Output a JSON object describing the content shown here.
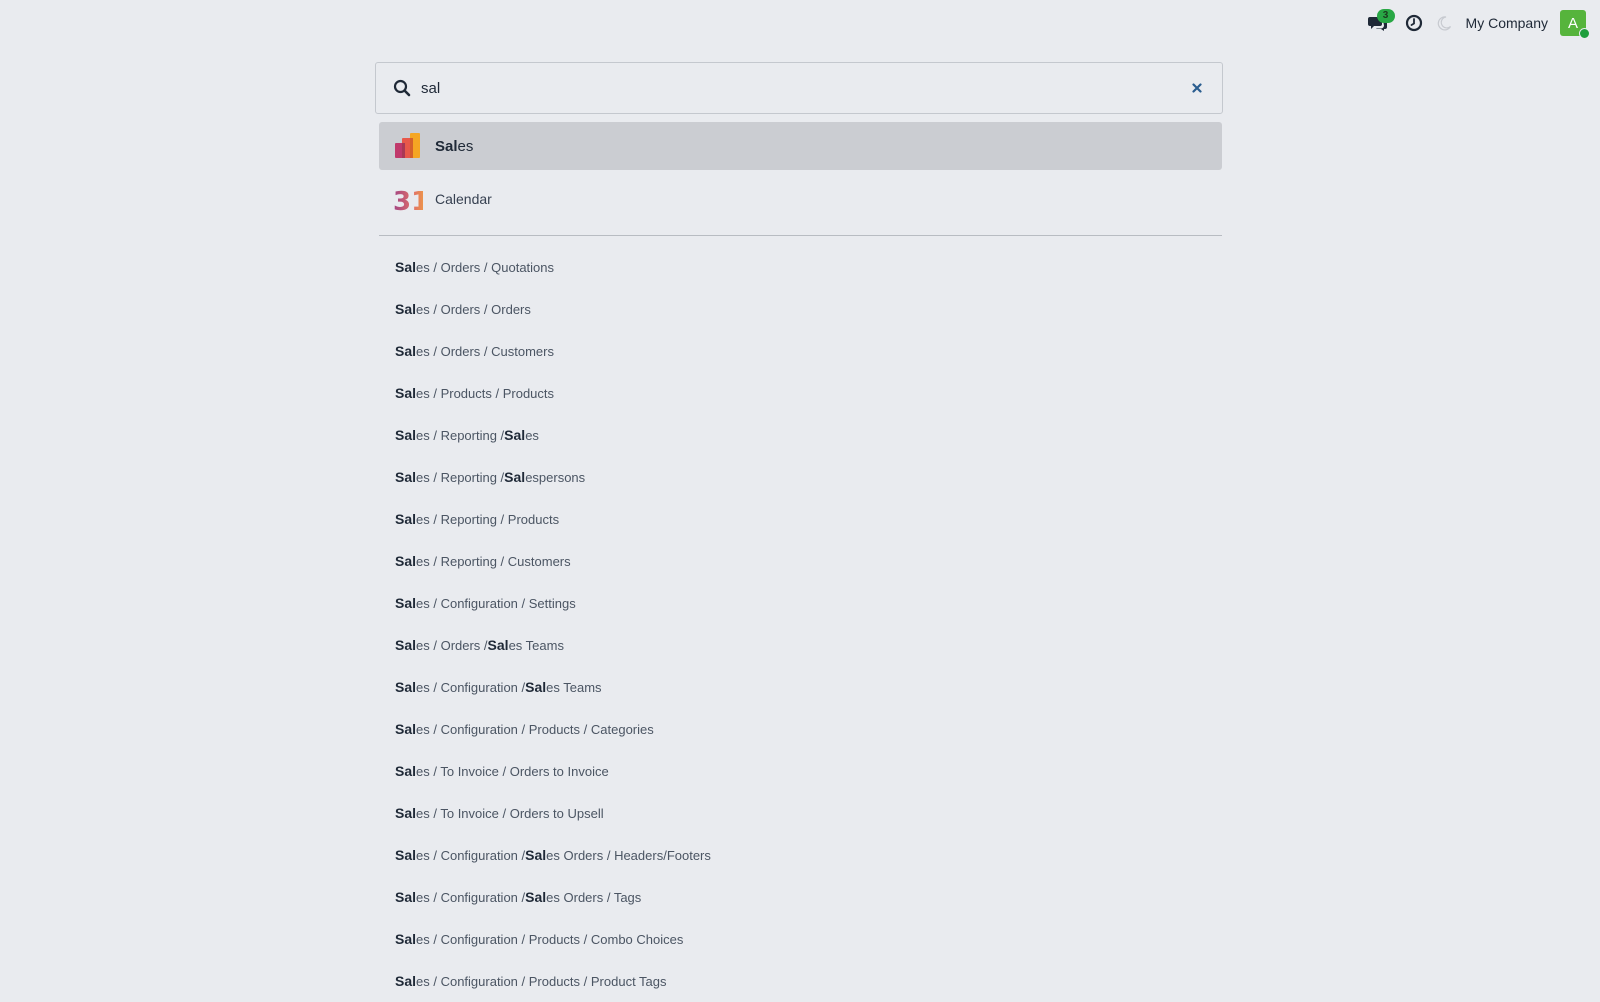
{
  "header": {
    "chat_badge": "3",
    "company": "My Company",
    "avatar_letter": "A",
    "icons": [
      "chat-icon",
      "clock-icon",
      "moon-icon"
    ]
  },
  "search": {
    "value": "sal",
    "placeholder": ""
  },
  "apps": [
    {
      "match": "Sal",
      "rest": "es",
      "icon": "sales-app-icon",
      "active": true
    },
    {
      "match": "",
      "rest": "Calendar",
      "icon": "calendar-app-icon",
      "active": false
    }
  ],
  "calendar_icon_text": "31",
  "menu_items": [
    {
      "segments": [
        {
          "t": "Sal",
          "b": true
        },
        {
          "t": "es / Orders / Quotations"
        }
      ]
    },
    {
      "segments": [
        {
          "t": "Sal",
          "b": true
        },
        {
          "t": "es / Orders / Orders"
        }
      ]
    },
    {
      "segments": [
        {
          "t": "Sal",
          "b": true
        },
        {
          "t": "es / Orders / Customers"
        }
      ]
    },
    {
      "segments": [
        {
          "t": "Sal",
          "b": true
        },
        {
          "t": "es / Products / Products"
        }
      ]
    },
    {
      "segments": [
        {
          "t": "Sal",
          "b": true
        },
        {
          "t": "es / Reporting / "
        },
        {
          "t": "Sal",
          "b": true
        },
        {
          "t": "es"
        }
      ]
    },
    {
      "segments": [
        {
          "t": "Sal",
          "b": true
        },
        {
          "t": "es / Reporting / "
        },
        {
          "t": "Sal",
          "b": true
        },
        {
          "t": "espersons"
        }
      ]
    },
    {
      "segments": [
        {
          "t": "Sal",
          "b": true
        },
        {
          "t": "es / Reporting / Products"
        }
      ]
    },
    {
      "segments": [
        {
          "t": "Sal",
          "b": true
        },
        {
          "t": "es / Reporting / Customers"
        }
      ]
    },
    {
      "segments": [
        {
          "t": "Sal",
          "b": true
        },
        {
          "t": "es / Configuration / Settings"
        }
      ]
    },
    {
      "segments": [
        {
          "t": "Sal",
          "b": true
        },
        {
          "t": "es / Orders / "
        },
        {
          "t": "Sal",
          "b": true
        },
        {
          "t": "es Teams"
        }
      ]
    },
    {
      "segments": [
        {
          "t": "Sal",
          "b": true
        },
        {
          "t": "es / Configuration / "
        },
        {
          "t": "Sal",
          "b": true
        },
        {
          "t": "es Teams"
        }
      ]
    },
    {
      "segments": [
        {
          "t": "Sal",
          "b": true
        },
        {
          "t": "es / Configuration / Products / Categories"
        }
      ]
    },
    {
      "segments": [
        {
          "t": "Sal",
          "b": true
        },
        {
          "t": "es / To Invoice / Orders to Invoice"
        }
      ]
    },
    {
      "segments": [
        {
          "t": "Sal",
          "b": true
        },
        {
          "t": "es / To Invoice / Orders to Upsell"
        }
      ]
    },
    {
      "segments": [
        {
          "t": "Sal",
          "b": true
        },
        {
          "t": "es / Configuration / "
        },
        {
          "t": "Sal",
          "b": true
        },
        {
          "t": "es Orders / Headers/Footers"
        }
      ]
    },
    {
      "segments": [
        {
          "t": "Sal",
          "b": true
        },
        {
          "t": "es / Configuration / "
        },
        {
          "t": "Sal",
          "b": true
        },
        {
          "t": "es Orders / Tags"
        }
      ]
    },
    {
      "segments": [
        {
          "t": "Sal",
          "b": true
        },
        {
          "t": "es / Configuration / Products / Combo Choices"
        }
      ]
    },
    {
      "segments": [
        {
          "t": "Sal",
          "b": true
        },
        {
          "t": "es / Configuration / Products / Product Tags"
        }
      ]
    }
  ],
  "colors": {
    "background": "#e9ebef",
    "active_row": "#cbcdd2",
    "badge": "#28a745",
    "avatar": "#56b43c",
    "clear_icon": "#2a5d8f"
  }
}
